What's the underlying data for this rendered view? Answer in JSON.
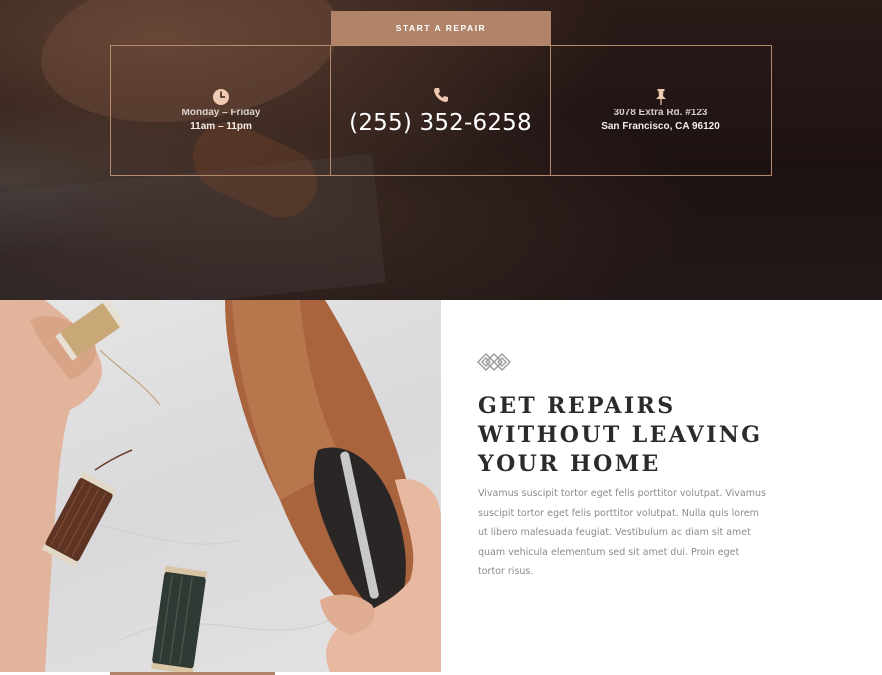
{
  "hero": {
    "cta_label": "START A REPAIR",
    "hours": {
      "icon": "clock-icon",
      "days": "Monday – Friday",
      "time": "11am – 11pm"
    },
    "phone": {
      "icon": "phone-icon",
      "number": "(255) 352-6258"
    },
    "address": {
      "icon": "pushpin-icon",
      "street": "3078 Extra Rd. #123",
      "city": "San Francisco, CA 96120"
    }
  },
  "feature": {
    "logo_icon": "diamond-pattern-icon",
    "headline_lines": [
      "GET REPAIRS",
      "WITHOUT LEAVING",
      "YOUR HOME"
    ],
    "body": "Vivamus suscipit tortor eget felis porttitor volutpat. Vivamus suscipit tortor eget felis porttitor volutpat. Nulla quis lorem ut libero malesuada feugiat. Vestibulum ac diam sit amet quam vehicula elementum sed sit amet dui. Proin eget tortor risus.",
    "image": "hands-repairing-leather-shoe-with-thread-spools"
  },
  "colors": {
    "accent": "#b1846a",
    "border": "#b58a6d",
    "hero_dark": "#1d1212",
    "headline": "#2b2b2b",
    "body_text": "#8b8b8b"
  }
}
